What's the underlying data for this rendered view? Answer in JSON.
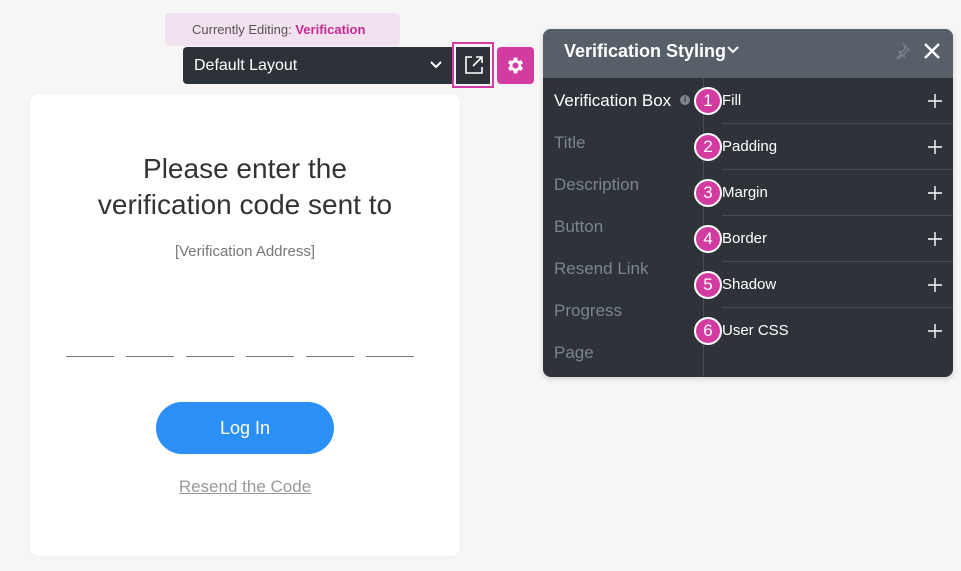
{
  "editing": {
    "prefix": "Currently Editing:",
    "target": "Verification"
  },
  "layout_select": {
    "value": "Default Layout",
    "icon": "chevron-down-icon"
  },
  "toolbar": {
    "open_icon": "external-link-icon",
    "settings_icon": "gear-icon"
  },
  "card": {
    "title_line1": "Please enter the",
    "title_line2": "verification code sent to",
    "address": "[Verification Address]",
    "code_slots": 6,
    "login_label": "Log In",
    "resend_label": "Resend the Code"
  },
  "panel": {
    "title": "Verification Styling",
    "nav": [
      {
        "label": "Verification Box",
        "active": true
      },
      {
        "label": "Title",
        "active": false
      },
      {
        "label": "Description",
        "active": false
      },
      {
        "label": "Button",
        "active": false
      },
      {
        "label": "Resend Link",
        "active": false
      },
      {
        "label": "Progress",
        "active": false
      },
      {
        "label": "Page",
        "active": false
      }
    ],
    "info_glyph": "i",
    "properties": [
      {
        "label": "Fill",
        "badge": "1"
      },
      {
        "label": "Padding",
        "badge": "2"
      },
      {
        "label": "Margin",
        "badge": "3"
      },
      {
        "label": "Border",
        "badge": "4"
      },
      {
        "label": "Shadow",
        "badge": "5"
      },
      {
        "label": "User CSS",
        "badge": "6"
      }
    ]
  },
  "colors": {
    "accent": "#d23b9f",
    "primary_button": "#2b8ff5",
    "panel_bg": "#2d3338",
    "panel_header": "#576068"
  }
}
